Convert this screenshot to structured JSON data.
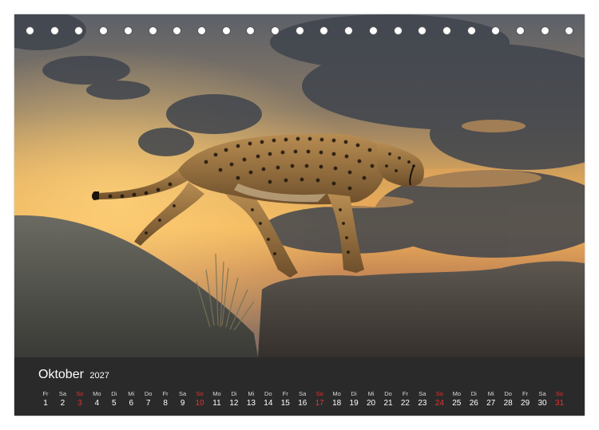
{
  "calendar": {
    "month": "Oktober",
    "year": "2027",
    "accent_color": "#e3342f",
    "days": [
      {
        "wd": "Fr",
        "d": "1"
      },
      {
        "wd": "Sa",
        "d": "2"
      },
      {
        "wd": "So",
        "d": "3"
      },
      {
        "wd": "Mo",
        "d": "4"
      },
      {
        "wd": "Di",
        "d": "5"
      },
      {
        "wd": "Mi",
        "d": "6"
      },
      {
        "wd": "Do",
        "d": "7"
      },
      {
        "wd": "Fr",
        "d": "8"
      },
      {
        "wd": "Sa",
        "d": "9"
      },
      {
        "wd": "So",
        "d": "10"
      },
      {
        "wd": "Mo",
        "d": "11"
      },
      {
        "wd": "Di",
        "d": "12"
      },
      {
        "wd": "Mi",
        "d": "13"
      },
      {
        "wd": "Do",
        "d": "14"
      },
      {
        "wd": "Fr",
        "d": "15"
      },
      {
        "wd": "Sa",
        "d": "16"
      },
      {
        "wd": "So",
        "d": "17"
      },
      {
        "wd": "Mo",
        "d": "18"
      },
      {
        "wd": "Di",
        "d": "19"
      },
      {
        "wd": "Mi",
        "d": "20"
      },
      {
        "wd": "Do",
        "d": "21"
      },
      {
        "wd": "Fr",
        "d": "22"
      },
      {
        "wd": "Sa",
        "d": "23"
      },
      {
        "wd": "So",
        "d": "24"
      },
      {
        "wd": "Mo",
        "d": "25"
      },
      {
        "wd": "Di",
        "d": "26"
      },
      {
        "wd": "Mi",
        "d": "27"
      },
      {
        "wd": "Do",
        "d": "28"
      },
      {
        "wd": "Fr",
        "d": "29"
      },
      {
        "wd": "Sa",
        "d": "30"
      },
      {
        "wd": "So",
        "d": "31"
      }
    ]
  },
  "photo": {
    "subject": "cheetah-on-rocks-at-sunset"
  },
  "binding": {
    "hole_count": 23
  }
}
